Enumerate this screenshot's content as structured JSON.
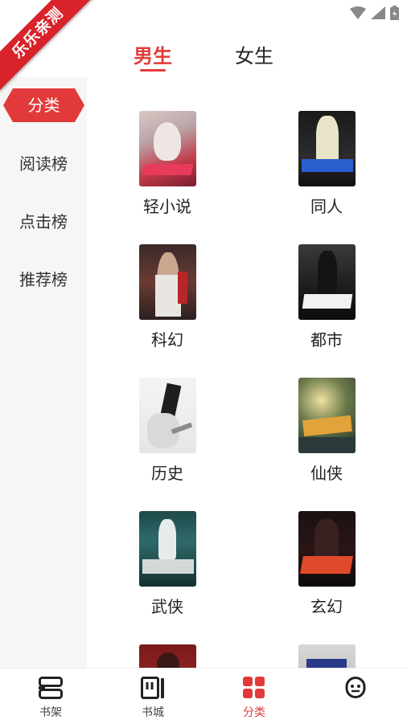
{
  "ribbon": {
    "text": "乐乐亲测"
  },
  "gender_tabs": [
    {
      "label": "男生",
      "active": true
    },
    {
      "label": "女生",
      "active": false
    }
  ],
  "sidebar": {
    "items": [
      {
        "label": "分类",
        "active": true
      },
      {
        "label": "阅读榜",
        "active": false
      },
      {
        "label": "点击榜",
        "active": false
      },
      {
        "label": "推荐榜",
        "active": false
      }
    ]
  },
  "categories": [
    {
      "label": "轻小说"
    },
    {
      "label": "同人"
    },
    {
      "label": "科幻"
    },
    {
      "label": "都市"
    },
    {
      "label": "历史"
    },
    {
      "label": "仙侠"
    },
    {
      "label": "武侠"
    },
    {
      "label": "玄幻"
    },
    {
      "label": ""
    },
    {
      "label": ""
    }
  ],
  "bottom_nav": [
    {
      "label": "书架",
      "icon": "bookshelf-icon",
      "active": false
    },
    {
      "label": "书城",
      "icon": "bookstore-icon",
      "active": false
    },
    {
      "label": "分类",
      "icon": "category-grid-icon",
      "active": true
    },
    {
      "label": "",
      "icon": "profile-icon",
      "active": false
    }
  ],
  "colors": {
    "accent": "#e23a3a",
    "sidebar_bg": "#f6f6f6"
  }
}
